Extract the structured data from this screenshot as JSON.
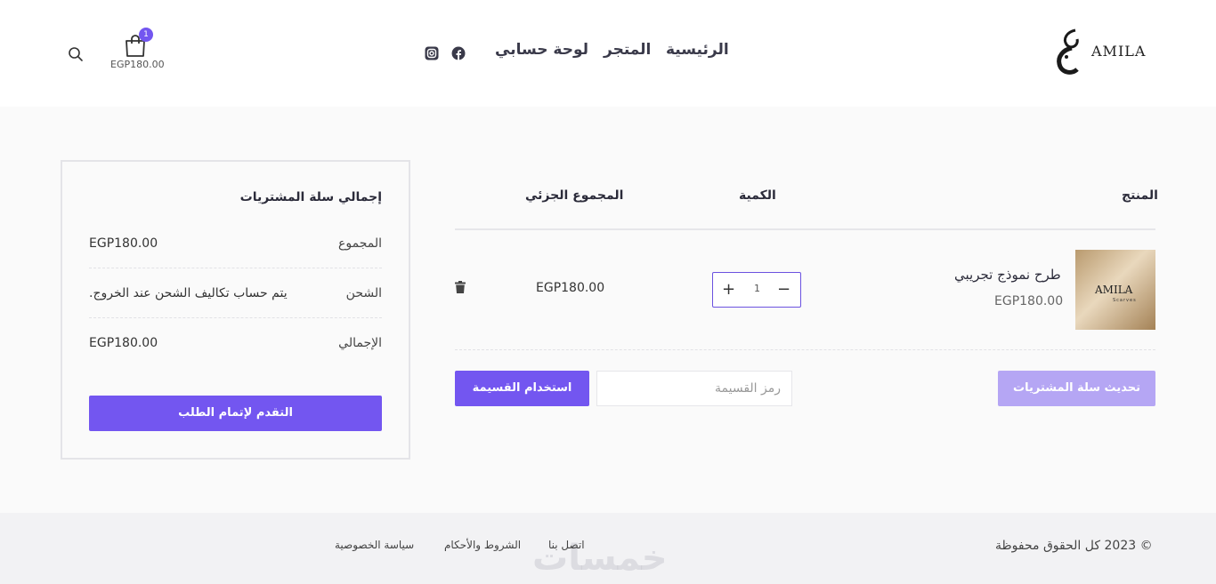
{
  "header": {
    "logo_text": "AMILA",
    "nav": {
      "home": "الرئيسية",
      "shop": "المتجر",
      "account": "لوحة حسابي"
    },
    "social_icons": [
      "facebook-icon",
      "instagram-icon"
    ],
    "cart": {
      "count": "1",
      "total": "EGP180.00"
    }
  },
  "cart": {
    "headers": {
      "product": "المنتج",
      "quantity": "الكمية",
      "subtotal": "المجموع الجزئي"
    },
    "items": [
      {
        "thumb_text": "AMILA",
        "thumb_sub": "Scarves",
        "name": "طرح نموذج تجريبي",
        "price": "EGP180.00",
        "quantity": "1",
        "subtotal": "EGP180.00"
      }
    ],
    "update_button": "تحديث سلة المشتريات",
    "coupon": {
      "placeholder": "رمز القسيمة",
      "button": "استخدام القسيمة"
    }
  },
  "totals": {
    "title": "إجمالي سلة المشتريات",
    "subtotal_label": "المجموع",
    "subtotal_value": "EGP180.00",
    "shipping_label": "الشحن",
    "shipping_value": "يتم حساب تكاليف الشحن عند الخروج.",
    "total_label": "الإجمالي",
    "total_value": "EGP180.00",
    "checkout_button": "التقدم لإتمام الطلب"
  },
  "footer": {
    "copyright": "© 2023 كل الحقوق محفوظة",
    "links": {
      "contact": "اتصل بنا",
      "terms": "الشروط والأحكام",
      "privacy": "سياسة الخصوصية"
    },
    "watermark": "خمسات"
  },
  "colors": {
    "accent": "#7356f0",
    "accent_light": "#b5a6f4",
    "background": "#fafafa",
    "footer_bg": "#f2f2f4"
  }
}
